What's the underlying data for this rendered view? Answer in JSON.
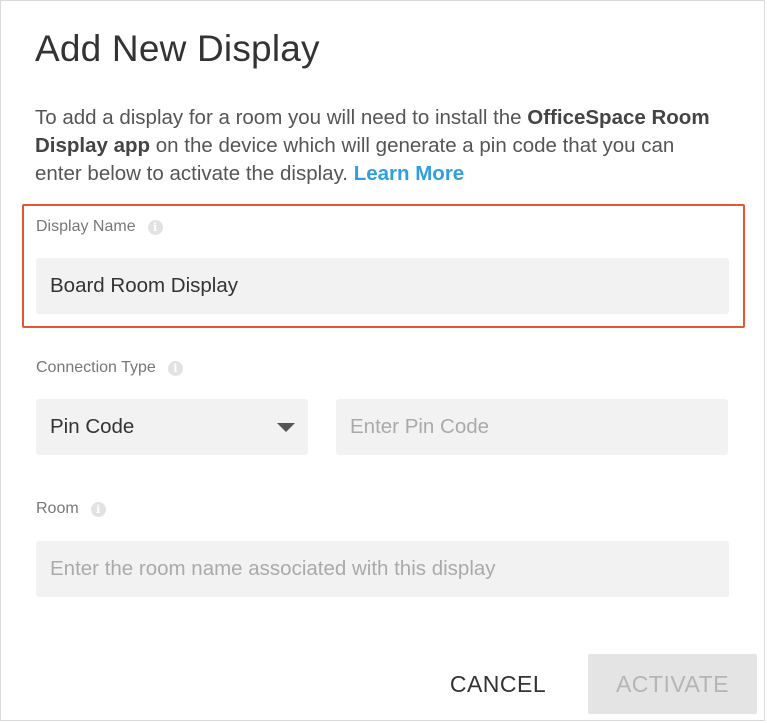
{
  "dialog": {
    "title": "Add New Display",
    "intro": {
      "text1": "To add a display for a room you will need to install the ",
      "app_name": "OfficeSpace Room Display app",
      "text2": " on the device which will generate a pin code that you can enter below to activate the display. ",
      "link": "Learn More"
    }
  },
  "fields": {
    "display_name": {
      "label": "Display Name",
      "value": "Board Room Display"
    },
    "connection_type": {
      "label": "Connection Type",
      "selected": "Pin Code",
      "pin_placeholder": "Enter Pin Code"
    },
    "room": {
      "label": "Room",
      "placeholder": "Enter the room name associated with this display"
    }
  },
  "buttons": {
    "cancel": "CANCEL",
    "activate": "ACTIVATE"
  },
  "colors": {
    "link": "#2f9fe0",
    "highlight_border": "#e4572e",
    "input_bg": "#f2f2f2"
  },
  "icons": {
    "info": "info-icon",
    "dropdown": "caret-down-icon"
  }
}
